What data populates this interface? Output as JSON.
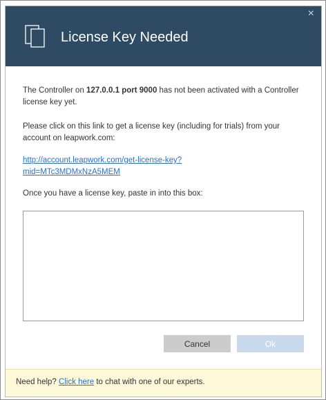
{
  "dialog": {
    "title": "License Key Needed",
    "close_glyph": "×",
    "header_color": "#2f4a63",
    "icon": "documents-icon"
  },
  "message": {
    "line1_prefix": "The Controller on ",
    "line1_host": "127.0.0.1 port 9000",
    "line1_suffix": " has not been activated with a Controller license key yet.",
    "instructions": "Please click on this link to get a license key (including for trials) from your account on leapwork.com:",
    "link_line1": "http://account.leapwork.com/get-license-key?",
    "link_line2": "mid=MTc3MDMxNzA5MEM",
    "paste_prompt": "Once you have a license key, paste in into this box:"
  },
  "license_input": {
    "value": "",
    "placeholder": ""
  },
  "buttons": {
    "cancel_label": "Cancel",
    "ok_label": "Ok"
  },
  "footer": {
    "prefix": "Need help? ",
    "link_label": "Click here",
    "suffix": " to chat with one of our experts.",
    "background": "#fcf8d8"
  }
}
